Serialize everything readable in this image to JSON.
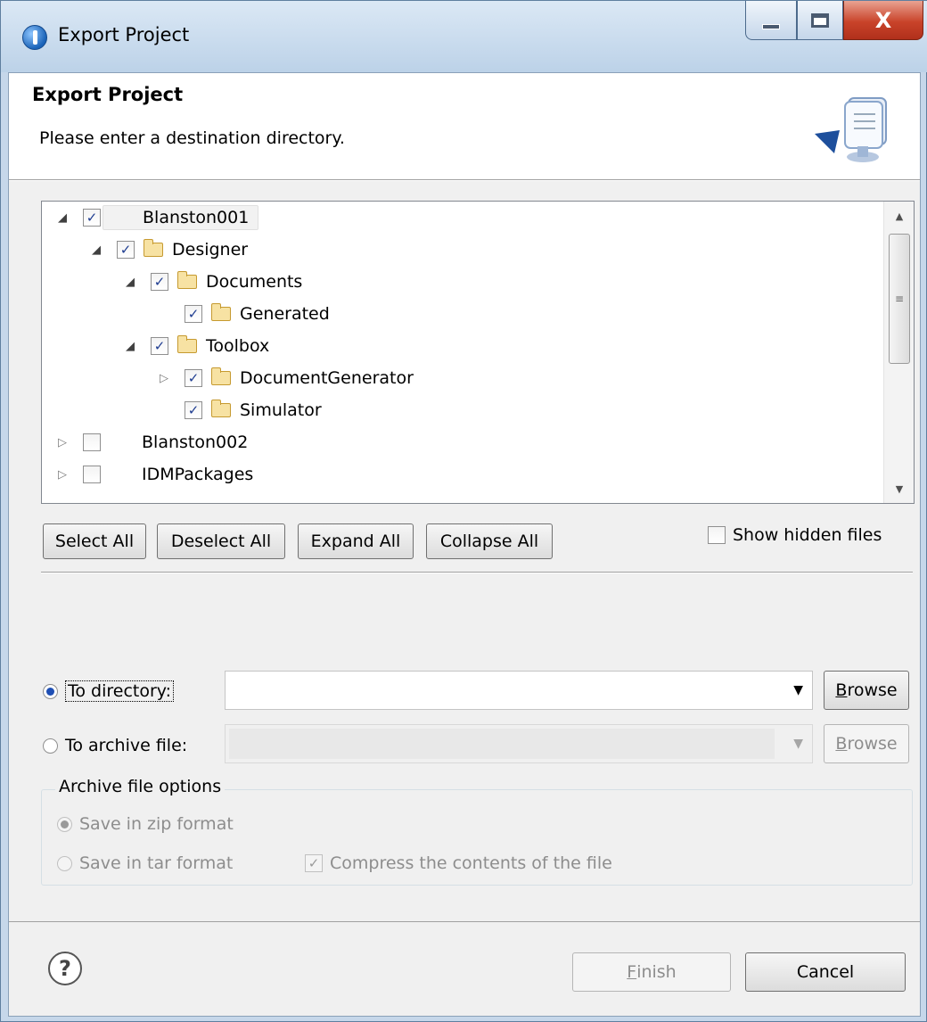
{
  "window": {
    "title": "Export Project",
    "close_glyph": "X"
  },
  "header": {
    "title": "Export Project",
    "description": "Please enter a destination directory.",
    "icon": "export-wizard-icon"
  },
  "tree": {
    "items": [
      {
        "label": "Blanston001",
        "checked": true,
        "expanded": true,
        "level": 0,
        "type": "project"
      },
      {
        "label": "Designer",
        "checked": true,
        "expanded": true,
        "level": 1,
        "type": "folder"
      },
      {
        "label": "Documents",
        "checked": true,
        "expanded": true,
        "level": 2,
        "type": "folder"
      },
      {
        "label": "Generated",
        "checked": true,
        "level": 3,
        "type": "folder"
      },
      {
        "label": "Toolbox",
        "checked": true,
        "expanded": true,
        "level": 2,
        "type": "folder"
      },
      {
        "label": "DocumentGenerator",
        "checked": true,
        "expanded": false,
        "level": 3,
        "type": "folder"
      },
      {
        "label": "Simulator",
        "checked": true,
        "level": 3,
        "type": "folder"
      },
      {
        "label": "Blanston002",
        "checked": false,
        "expanded": false,
        "level": 0,
        "type": "project"
      },
      {
        "label": "IDMPackages",
        "checked": false,
        "expanded": false,
        "level": 0,
        "type": "project"
      }
    ],
    "check_glyph": "✓"
  },
  "buttons": {
    "select_all": "Select All",
    "deselect_all": "Deselect All",
    "expand_all": "Expand All",
    "collapse_all": "Collapse All",
    "browse_mnemonic": "B",
    "browse_rest": "rowse",
    "finish_mnemonic": "F",
    "finish_rest": "inish",
    "cancel": "Cancel"
  },
  "show_hidden": {
    "label": "Show hidden files",
    "checked": false
  },
  "destination": {
    "to_directory_label": "To directory:",
    "to_archive_label": "To archive file:",
    "selected": "to_directory",
    "directory_value": "",
    "archive_value": ""
  },
  "archive_options": {
    "title": "Archive file options",
    "zip_label": "Save in zip format",
    "tar_label": "Save in tar format",
    "compress_label": "Compress the contents of the file",
    "compress_checked": true,
    "enabled": false
  },
  "footer": {
    "help_glyph": "?"
  }
}
